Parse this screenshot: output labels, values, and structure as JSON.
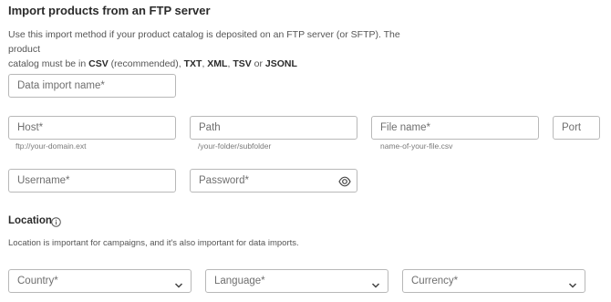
{
  "header": {
    "title": "Import products from an FTP server",
    "description_lines": [
      "Use this import method if your product catalog is deposited on an FTP server (or SFTP). The product",
      "catalog must be in"
    ],
    "formats": {
      "csv": "CSV",
      "csv_note": "(recommended),",
      "txt": "TXT",
      "xml": "XML",
      "tsv": "TSV",
      "or": "or",
      "jsonl": "JSONL"
    }
  },
  "form": {
    "import_name": {
      "placeholder": "Data import name*",
      "value": ""
    },
    "host": {
      "placeholder": "Host*",
      "hint": "ftp://your-domain.ext",
      "value": ""
    },
    "path": {
      "placeholder": "Path",
      "hint": "/your-folder/subfolder",
      "value": ""
    },
    "file_name": {
      "placeholder": "File name*",
      "hint": "name-of-your-file.csv",
      "value": ""
    },
    "port": {
      "placeholder": "Port",
      "value": ""
    },
    "username": {
      "placeholder": "Username*",
      "value": ""
    },
    "password": {
      "placeholder": "Password*",
      "value": "",
      "icon": "eye-icon"
    }
  },
  "location": {
    "title": "Location",
    "icon": "info-icon",
    "description": "Location is important for campaigns, and it's also important for data imports.",
    "country": {
      "label": "Country*"
    },
    "language": {
      "label": "Language*"
    },
    "currency": {
      "label": "Currency*"
    }
  },
  "colors": {
    "border": "#b8b8b8",
    "text": "#333333",
    "muted": "#6f6f6f"
  }
}
